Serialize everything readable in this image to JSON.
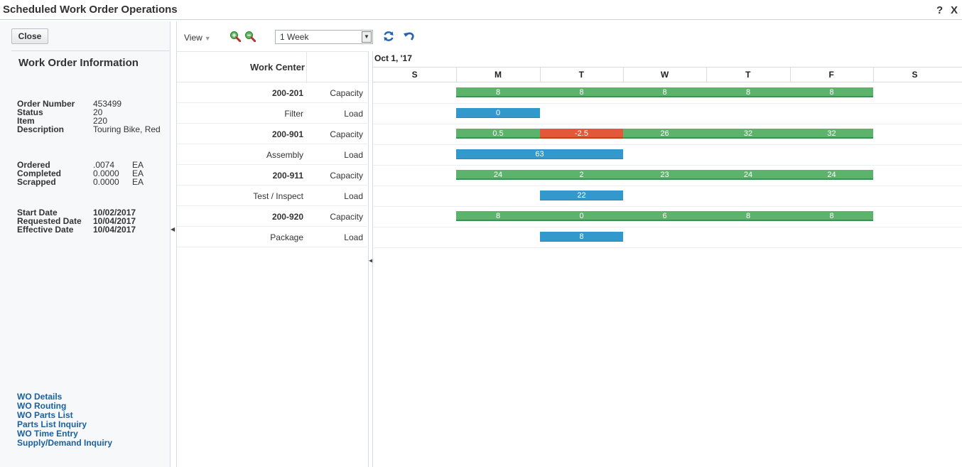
{
  "window": {
    "title": "Scheduled Work Order Operations",
    "help": "?",
    "close": "X"
  },
  "left": {
    "close_label": "Close",
    "heading": "Work Order Information",
    "fields": [
      {
        "k": "Order Number",
        "v": "453499"
      },
      {
        "k": "Status",
        "v": "20"
      },
      {
        "k": "Item",
        "v": "220"
      },
      {
        "k": "Description",
        "v": "Touring Bike, Red"
      }
    ],
    "quantities": [
      {
        "k": "Ordered",
        "v": ".0074",
        "u": "EA"
      },
      {
        "k": "Completed",
        "v": "0.0000",
        "u": "EA"
      },
      {
        "k": "Scrapped",
        "v": "0.0000",
        "u": "EA"
      }
    ],
    "dates": [
      {
        "k": "Start Date",
        "v": "10/02/2017"
      },
      {
        "k": "Requested Date",
        "v": "10/04/2017"
      },
      {
        "k": "Effective Date",
        "v": "10/04/2017"
      }
    ],
    "links": [
      "WO Details",
      "WO Routing",
      "WO Parts List",
      "Parts List Inquiry",
      "WO Time Entry",
      "Supply/Demand Inquiry"
    ]
  },
  "toolbar": {
    "view_label": "View",
    "range_value": "1 Week"
  },
  "grid": {
    "header": "Work Center",
    "rows": [
      {
        "name": "200-201",
        "type": "Capacity",
        "bold": true
      },
      {
        "name": "Filter",
        "type": "Load",
        "bold": false
      },
      {
        "name": "200-901",
        "type": "Capacity",
        "bold": true
      },
      {
        "name": "Assembly",
        "type": "Load",
        "bold": false
      },
      {
        "name": "200-911",
        "type": "Capacity",
        "bold": true
      },
      {
        "name": "Test / Inspect",
        "type": "Load",
        "bold": false
      },
      {
        "name": "200-920",
        "type": "Capacity",
        "bold": true
      },
      {
        "name": "Package",
        "type": "Load",
        "bold": false
      }
    ]
  },
  "gantt": {
    "date_label": "Oct 1, '17",
    "days": [
      "S",
      "M",
      "T",
      "W",
      "T",
      "F",
      "S"
    ],
    "bars": [
      {
        "row": 0,
        "kind": "cap",
        "segments": [
          {
            "d": 1,
            "label": "8",
            "color": "green"
          },
          {
            "d": 2,
            "label": "8",
            "color": "green"
          },
          {
            "d": 3,
            "label": "8",
            "color": "green"
          },
          {
            "d": 4,
            "label": "8",
            "color": "green"
          },
          {
            "d": 5,
            "label": "8",
            "color": "green"
          }
        ]
      },
      {
        "row": 1,
        "kind": "load",
        "segments": [
          {
            "d": 1,
            "label": "0"
          }
        ]
      },
      {
        "row": 2,
        "kind": "cap",
        "segments": [
          {
            "d": 1,
            "label": "0.5",
            "color": "green"
          },
          {
            "d": 2,
            "label": "-2.5",
            "color": "red"
          },
          {
            "d": 3,
            "label": "26",
            "color": "green"
          },
          {
            "d": 4,
            "label": "32",
            "color": "green"
          },
          {
            "d": 5,
            "label": "32",
            "color": "green"
          }
        ]
      },
      {
        "row": 3,
        "kind": "load",
        "span": [
          1,
          2
        ],
        "label": "63"
      },
      {
        "row": 4,
        "kind": "cap",
        "segments": [
          {
            "d": 1,
            "label": "24",
            "color": "green"
          },
          {
            "d": 2,
            "label": "2",
            "color": "green"
          },
          {
            "d": 3,
            "label": "23",
            "color": "green"
          },
          {
            "d": 4,
            "label": "24",
            "color": "green"
          },
          {
            "d": 5,
            "label": "24",
            "color": "green"
          }
        ]
      },
      {
        "row": 5,
        "kind": "load",
        "segments": [
          {
            "d": 2,
            "label": "22"
          }
        ]
      },
      {
        "row": 6,
        "kind": "cap",
        "segments": [
          {
            "d": 1,
            "label": "8",
            "color": "green"
          },
          {
            "d": 2,
            "label": "0",
            "color": "green"
          },
          {
            "d": 3,
            "label": "6",
            "color": "green"
          },
          {
            "d": 4,
            "label": "8",
            "color": "green"
          },
          {
            "d": 5,
            "label": "8",
            "color": "green"
          }
        ]
      },
      {
        "row": 7,
        "kind": "load",
        "segments": [
          {
            "d": 2,
            "label": "8"
          }
        ]
      }
    ]
  }
}
